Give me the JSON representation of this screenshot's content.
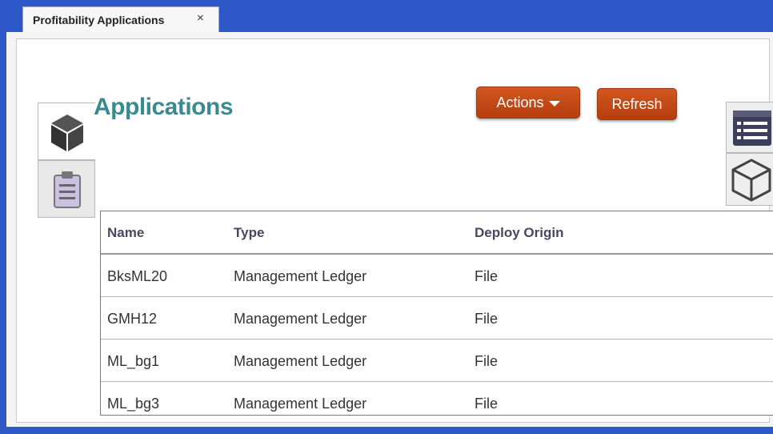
{
  "tab": {
    "label": "Profitability Applications",
    "close": "×"
  },
  "page": {
    "title": "Applications"
  },
  "toolbar": {
    "actions_label": "Actions",
    "refresh_label": "Refresh"
  },
  "side_tabs": [
    {
      "icon": "cube-icon"
    },
    {
      "icon": "clipboard-icon"
    }
  ],
  "right_tabs": [
    {
      "icon": "list-icon"
    },
    {
      "icon": "cube-outline-icon"
    }
  ],
  "table": {
    "columns": [
      "Name",
      "Type",
      "Deploy Origin"
    ],
    "rows": [
      [
        "BksML20",
        "Management Ledger",
        "File"
      ],
      [
        "GMH12",
        "Management Ledger",
        "File"
      ],
      [
        "ML_bg1",
        "Management Ledger",
        "File"
      ],
      [
        "ML_bg3",
        "Management Ledger",
        "File"
      ]
    ]
  },
  "colors": {
    "accent": "#3b8a8e",
    "button": "#c44b16",
    "frame": "#2e57c8"
  }
}
